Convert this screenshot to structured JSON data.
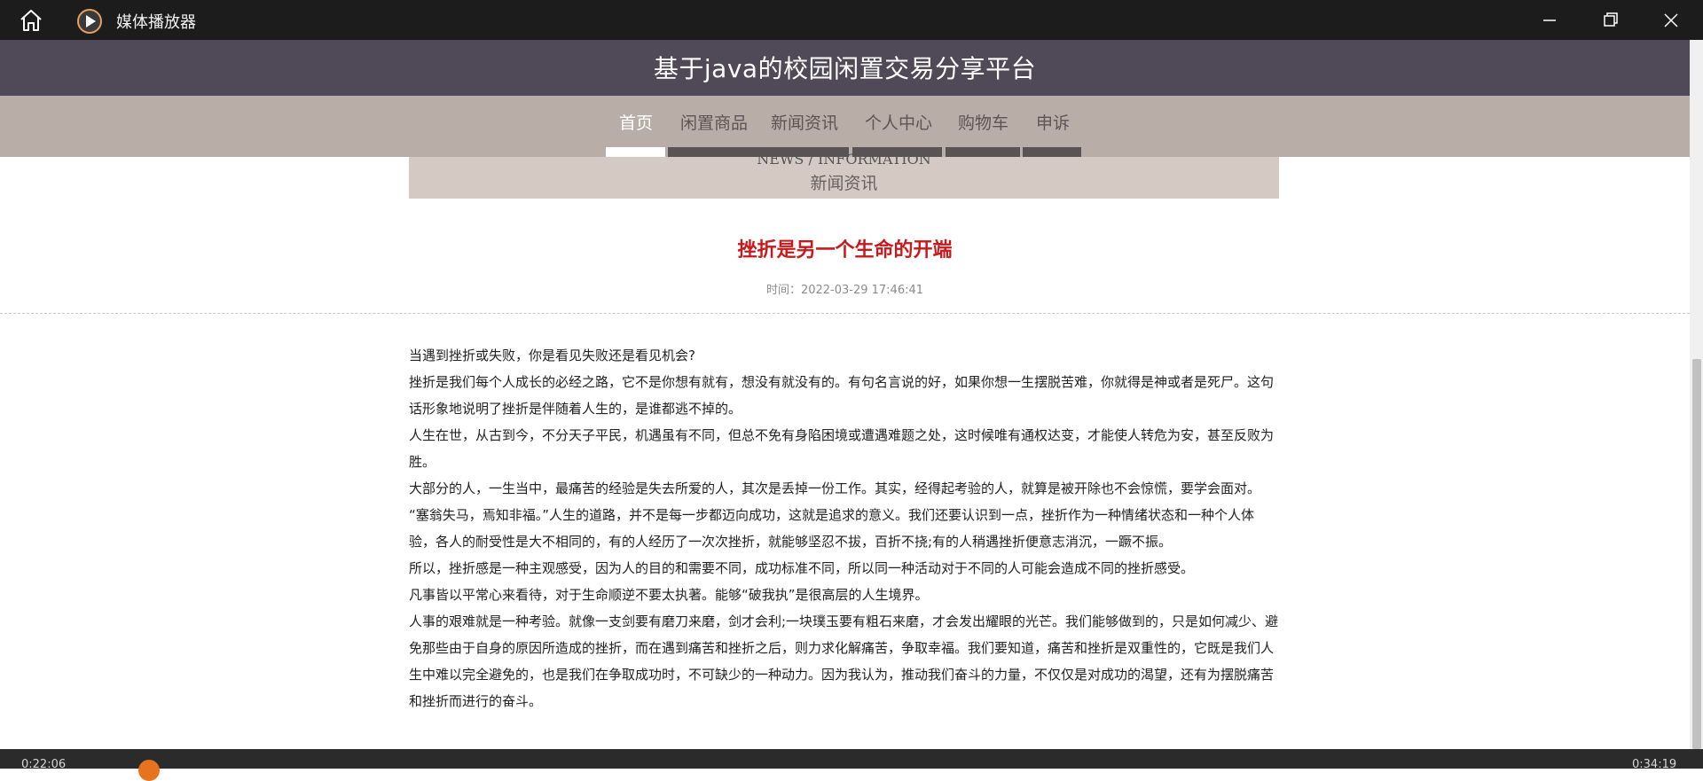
{
  "player": {
    "title": "媒体播放器",
    "time_current": "0:22:06",
    "time_total": "0:34:19"
  },
  "site": {
    "title": "基于java的校园闲置交易分享平台",
    "nav": [
      "首页",
      "闲置商品",
      "新闻资讯",
      "个人中心",
      "购物车",
      "申诉"
    ],
    "active_nav": "首页"
  },
  "banner": {
    "en": "NEWS / INFORMATION",
    "cn": "新闻资讯"
  },
  "article": {
    "title": "挫折是另一个生命的开端",
    "time": "时间：2022-03-29 17:46:41",
    "paragraphs": [
      "当遇到挫折或失败，你是看见失败还是看见机会?",
      "挫折是我们每个人成长的必经之路，它不是你想有就有，想没有就没有的。有句名言说的好，如果你想一生摆脱苦难，你就得是神或者是死尸。这句话形象地说明了挫折是伴随着人生的，是谁都逃不掉的。",
      "人生在世，从古到今，不分天子平民，机遇虽有不同，但总不免有身陷困境或遭遇难题之处，这时候唯有通权达变，才能使人转危为安，甚至反败为胜。",
      "大部分的人，一生当中，最痛苦的经验是失去所爱的人，其次是丢掉一份工作。其实，经得起考验的人，就算是被开除也不会惊慌，要学会面对。",
      "“塞翁失马，焉知非福。”人生的道路，并不是每一步都迈向成功，这就是追求的意义。我们还要认识到一点，挫折作为一种情绪状态和一种个人体验，各人的耐受性是大不相同的，有的人经历了一次次挫折，就能够坚忍不拔，百折不挠;有的人稍遇挫折便意志消沉，一蹶不振。",
      "所以，挫折感是一种主观感受，因为人的目的和需要不同，成功标准不同，所以同一种活动对于不同的人可能会造成不同的挫折感受。",
      "凡事皆以平常心来看待，对于生命顺逆不要太执著。能够“破我执”是很高层的人生境界。",
      "人事的艰难就是一种考验。就像一支剑要有磨刀来磨，剑才会利;一块璞玉要有粗石来磨，才会发出耀眼的光芒。我们能够做到的，只是如何减少、避免那些由于自身的原因所造成的挫折，而在遇到痛苦和挫折之后，则力求化解痛苦，争取幸福。我们要知道，痛苦和挫折是双重性的，它既是我们人生中难以完全避免的，也是我们在争取成功时，不可缺少的一种动力。因为我认为，推动我们奋斗的力量，不仅仅是对成功的渴望，还有为摆脱痛苦和挫折而进行的奋斗。"
    ]
  },
  "colors": {
    "titlebar": "#1c1c1c",
    "site_header": "#4f4958",
    "nav_bg": "#b9ada8",
    "banner_bg": "#d4c9c3",
    "article_title": "#c8191c",
    "progress_accent": "#e8731f"
  }
}
